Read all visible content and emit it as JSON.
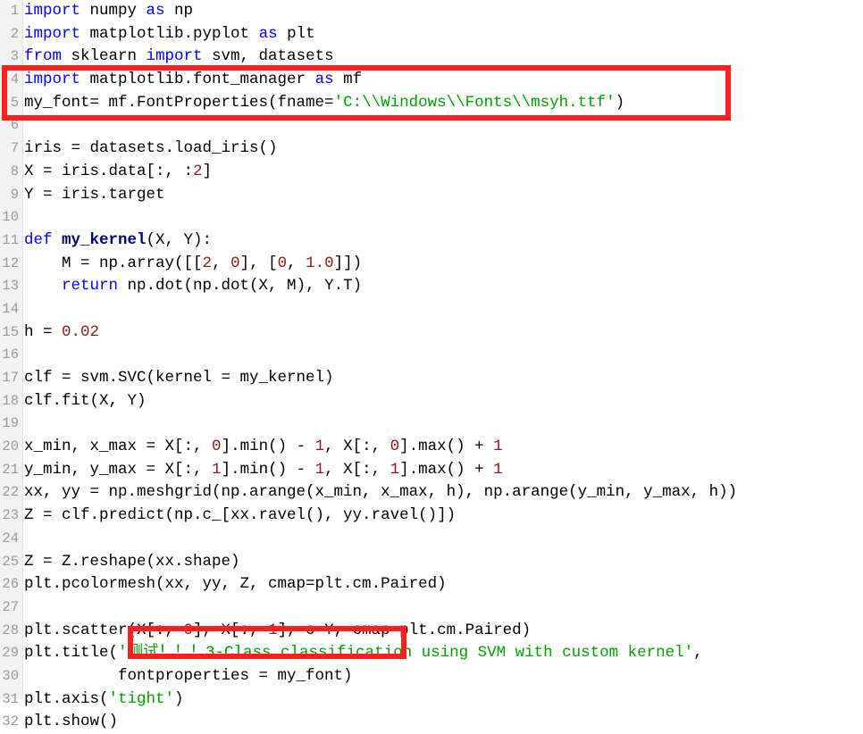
{
  "editor": {
    "language": "python",
    "total_lines": 32,
    "background_color": "#ffffff",
    "gutter_color": "#f2f2f2",
    "keyword_color": "#0000ff",
    "string_color": "#00a000",
    "number_color": "#8b1a1a",
    "function_color": "#00007f",
    "annotation_color": "#fe2020"
  },
  "line_numbers": [
    "1",
    "2",
    "3",
    "4",
    "5",
    "6",
    "7",
    "8",
    "9",
    "10",
    "11",
    "12",
    "13",
    "14",
    "15",
    "16",
    "17",
    "18",
    "19",
    "20",
    "21",
    "22",
    "23",
    "24",
    "25",
    "26",
    "27",
    "28",
    "29",
    "30",
    "31",
    "32"
  ],
  "lines": [
    {
      "n": "1",
      "plain": "import numpy as np"
    },
    {
      "n": "2",
      "plain": "import matplotlib.pyplot as plt"
    },
    {
      "n": "3",
      "plain": "from sklearn import svm, datasets"
    },
    {
      "n": "4",
      "plain": "import matplotlib.font_manager as mf"
    },
    {
      "n": "5",
      "plain": "my_font= mf.FontProperties(fname='C:\\\\Windows\\\\Fonts\\\\msyh.ttf')"
    },
    {
      "n": "6",
      "plain": ""
    },
    {
      "n": "7",
      "plain": "iris = datasets.load_iris()"
    },
    {
      "n": "8",
      "plain": "X = iris.data[:, :2]"
    },
    {
      "n": "9",
      "plain": "Y = iris.target"
    },
    {
      "n": "10",
      "plain": ""
    },
    {
      "n": "11",
      "plain": "def my_kernel(X, Y):"
    },
    {
      "n": "12",
      "plain": "    M = np.array([[2, 0], [0, 1.0]])"
    },
    {
      "n": "13",
      "plain": "    return np.dot(np.dot(X, M), Y.T)"
    },
    {
      "n": "14",
      "plain": ""
    },
    {
      "n": "15",
      "plain": "h = 0.02"
    },
    {
      "n": "16",
      "plain": ""
    },
    {
      "n": "17",
      "plain": "clf = svm.SVC(kernel = my_kernel)"
    },
    {
      "n": "18",
      "plain": "clf.fit(X, Y)"
    },
    {
      "n": "19",
      "plain": ""
    },
    {
      "n": "20",
      "plain": "x_min, x_max = X[:, 0].min() - 1, X[:, 0].max() + 1"
    },
    {
      "n": "21",
      "plain": "y_min, y_max = X[:, 1].min() - 1, X[:, 1].max() + 1"
    },
    {
      "n": "22",
      "plain": "xx, yy = np.meshgrid(np.arange(x_min, x_max, h), np.arange(y_min, y_max, h))"
    },
    {
      "n": "23",
      "plain": "Z = clf.predict(np.c_[xx.ravel(), yy.ravel()])"
    },
    {
      "n": "24",
      "plain": ""
    },
    {
      "n": "25",
      "plain": "Z = Z.reshape(xx.shape)"
    },
    {
      "n": "26",
      "plain": "plt.pcolormesh(xx, yy, Z, cmap=plt.cm.Paired)"
    },
    {
      "n": "27",
      "plain": ""
    },
    {
      "n": "28",
      "plain": "plt.scatter(X[:, 0], X[:, 1], c=Y, cmap=plt.cm.Paired)"
    },
    {
      "n": "29",
      "plain": "plt.title('测试！！！3-Class classification using SVM with custom kernel',"
    },
    {
      "n": "30",
      "plain": "          fontproperties = my_font)"
    },
    {
      "n": "31",
      "plain": "plt.axis('tight')"
    },
    {
      "n": "32",
      "plain": "plt.show()"
    }
  ],
  "tokens": {
    "l1": [
      {
        "t": "import",
        "c": "kw"
      },
      {
        "t": " numpy ",
        "c": "plain"
      },
      {
        "t": "as",
        "c": "kw"
      },
      {
        "t": " np",
        "c": "plain"
      }
    ],
    "l2": [
      {
        "t": "import",
        "c": "kw"
      },
      {
        "t": " matplotlib.pyplot ",
        "c": "plain"
      },
      {
        "t": "as",
        "c": "kw"
      },
      {
        "t": " plt",
        "c": "plain"
      }
    ],
    "l3": [
      {
        "t": "from",
        "c": "kw"
      },
      {
        "t": " sklearn ",
        "c": "plain"
      },
      {
        "t": "import",
        "c": "kw"
      },
      {
        "t": " svm, datasets",
        "c": "plain"
      }
    ],
    "l4": [
      {
        "t": "import",
        "c": "kw"
      },
      {
        "t": " matplotlib.font_manager ",
        "c": "plain"
      },
      {
        "t": "as",
        "c": "kw"
      },
      {
        "t": " mf",
        "c": "plain"
      }
    ],
    "l5": [
      {
        "t": "my_font= mf.FontProperties(fname=",
        "c": "plain"
      },
      {
        "t": "'C:\\\\Windows\\\\Fonts\\\\msyh.ttf'",
        "c": "str"
      },
      {
        "t": ")",
        "c": "plain"
      }
    ],
    "l6": [],
    "l7": [
      {
        "t": "iris = datasets.load_iris()",
        "c": "plain"
      }
    ],
    "l8": [
      {
        "t": "X = iris.data[:, :",
        "c": "plain"
      },
      {
        "t": "2",
        "c": "num"
      },
      {
        "t": "]",
        "c": "plain"
      }
    ],
    "l9": [
      {
        "t": "Y = iris.target",
        "c": "plain"
      }
    ],
    "l10": [],
    "l11": [
      {
        "t": "def",
        "c": "kw"
      },
      {
        "t": " ",
        "c": "plain"
      },
      {
        "t": "my_kernel",
        "c": "fn"
      },
      {
        "t": "(X, Y):",
        "c": "plain"
      }
    ],
    "l12": [
      {
        "t": "    M = np.array([[",
        "c": "plain"
      },
      {
        "t": "2",
        "c": "num"
      },
      {
        "t": ", ",
        "c": "plain"
      },
      {
        "t": "0",
        "c": "num"
      },
      {
        "t": "], [",
        "c": "plain"
      },
      {
        "t": "0",
        "c": "num"
      },
      {
        "t": ", ",
        "c": "plain"
      },
      {
        "t": "1.0",
        "c": "num"
      },
      {
        "t": "]])",
        "c": "plain"
      }
    ],
    "l13": [
      {
        "t": "    ",
        "c": "plain"
      },
      {
        "t": "return",
        "c": "kw"
      },
      {
        "t": " np.dot(np.dot(X, M), Y.T)",
        "c": "plain"
      }
    ],
    "l14": [],
    "l15": [
      {
        "t": "h = ",
        "c": "plain"
      },
      {
        "t": "0.02",
        "c": "num"
      }
    ],
    "l16": [],
    "l17": [
      {
        "t": "clf = svm.SVC(kernel = my_kernel)",
        "c": "plain"
      }
    ],
    "l18": [
      {
        "t": "clf.fit(X, Y)",
        "c": "plain"
      }
    ],
    "l19": [],
    "l20": [
      {
        "t": "x_min, x_max = X[:, ",
        "c": "plain"
      },
      {
        "t": "0",
        "c": "num"
      },
      {
        "t": "].min() - ",
        "c": "plain"
      },
      {
        "t": "1",
        "c": "num"
      },
      {
        "t": ", X[:, ",
        "c": "plain"
      },
      {
        "t": "0",
        "c": "num"
      },
      {
        "t": "].max() + ",
        "c": "plain"
      },
      {
        "t": "1",
        "c": "num"
      }
    ],
    "l21": [
      {
        "t": "y_min, y_max = X[:, ",
        "c": "plain"
      },
      {
        "t": "1",
        "c": "num"
      },
      {
        "t": "].min() - ",
        "c": "plain"
      },
      {
        "t": "1",
        "c": "num"
      },
      {
        "t": ", X[:, ",
        "c": "plain"
      },
      {
        "t": "1",
        "c": "num"
      },
      {
        "t": "].max() + ",
        "c": "plain"
      },
      {
        "t": "1",
        "c": "num"
      }
    ],
    "l22": [
      {
        "t": "xx, yy = np.meshgrid(np.arange(x_min, x_max, h), np.arange(y_min, y_max, h))",
        "c": "plain"
      }
    ],
    "l23": [
      {
        "t": "Z = clf.predict(np.c_[xx.ravel(), yy.ravel()])",
        "c": "plain"
      }
    ],
    "l24": [],
    "l25": [
      {
        "t": "Z = Z.reshape(xx.shape)",
        "c": "plain"
      }
    ],
    "l26": [
      {
        "t": "plt.pcolormesh(xx, yy, Z, cmap=plt.cm.Paired)",
        "c": "plain"
      }
    ],
    "l27": [],
    "l28": [
      {
        "t": "plt.scatter(X[:, ",
        "c": "plain"
      },
      {
        "t": "0",
        "c": "num"
      },
      {
        "t": "], X[:, ",
        "c": "plain"
      },
      {
        "t": "1",
        "c": "num"
      },
      {
        "t": "], c=Y, cmap=plt.cm.Paired)",
        "c": "plain"
      }
    ],
    "l29": [
      {
        "t": "plt.title(",
        "c": "plain"
      },
      {
        "t": "'测试！！！3-Class classification using SVM with custom kernel'",
        "c": "str"
      },
      {
        "t": ",",
        "c": "plain"
      }
    ],
    "l30": [
      {
        "t": "          fontproperties = my_font)",
        "c": "plain"
      }
    ],
    "l31": [
      {
        "t": "plt.axis(",
        "c": "plain"
      },
      {
        "t": "'tight'",
        "c": "str"
      },
      {
        "t": ")",
        "c": "plain"
      }
    ],
    "l32": [
      {
        "t": "plt.show()",
        "c": "plain"
      }
    ]
  },
  "annotations": [
    {
      "name": "font-import-highlight",
      "lines": "4-5",
      "color": "#fe2020"
    },
    {
      "name": "fontproperties-highlight",
      "lines": "30",
      "color": "#fe2020"
    }
  ]
}
